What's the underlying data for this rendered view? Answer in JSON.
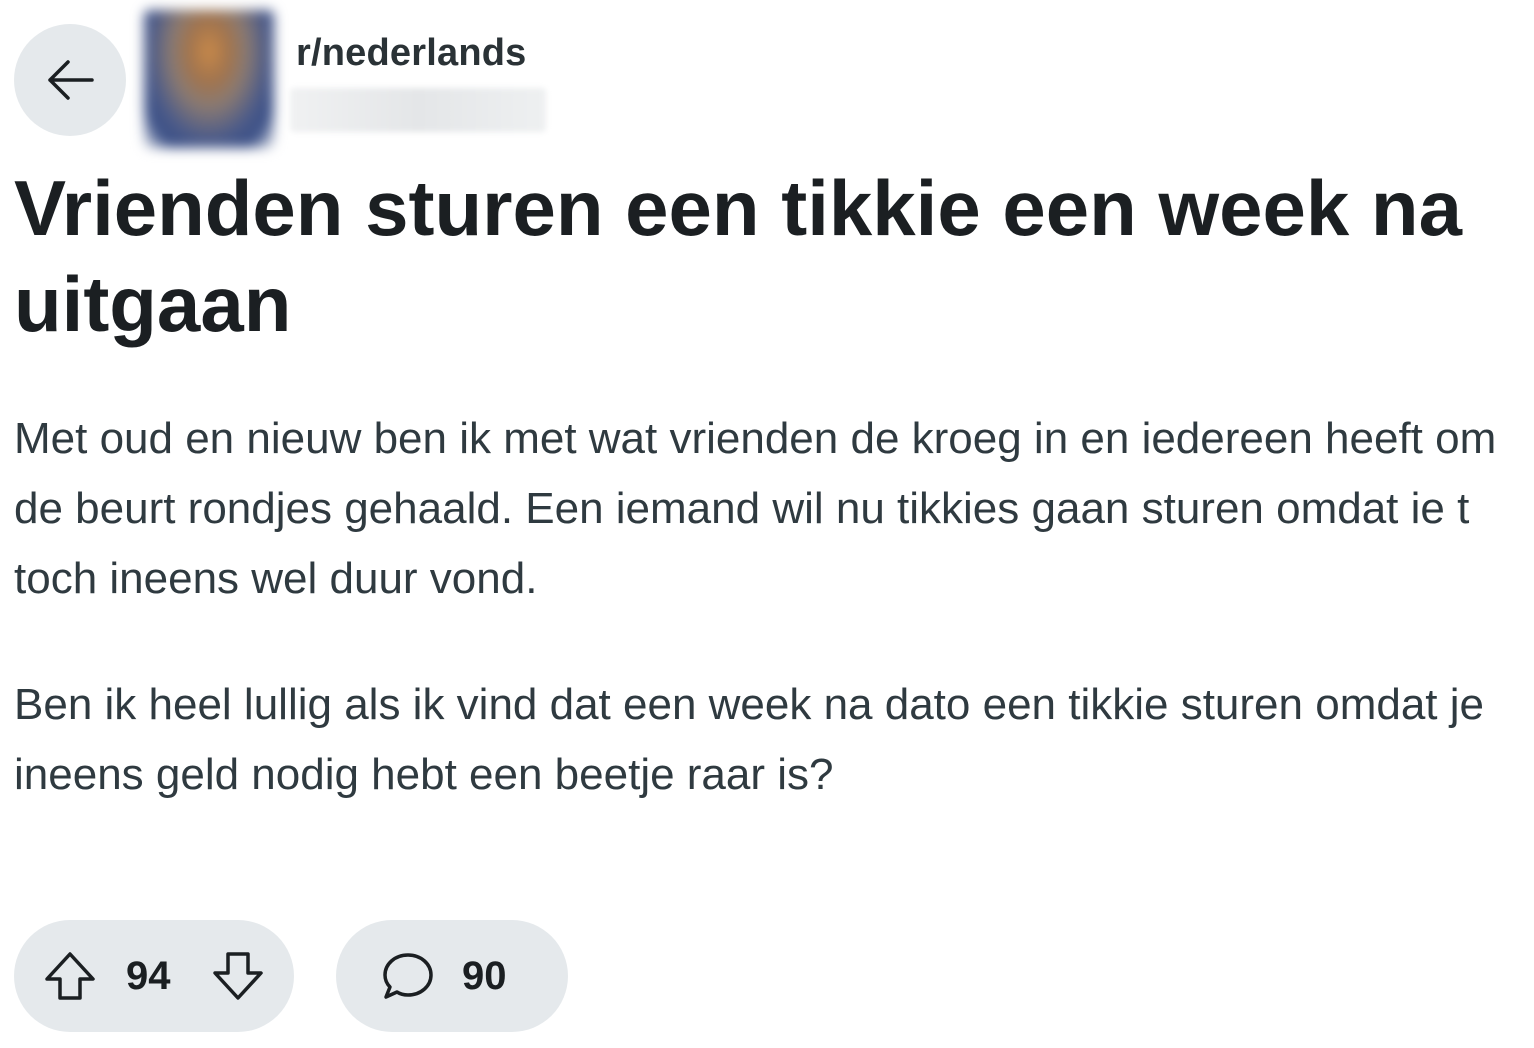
{
  "post": {
    "subreddit": "r/nederlands",
    "title": "Vrienden sturen een tikkie een week na uitgaan",
    "body": [
      "Met oud en nieuw ben ik met wat vrienden de kroeg in en iedereen heeft om de beurt rondjes gehaald. Een iemand wil nu tikkies gaan sturen omdat ie t toch ineens wel duur vond.",
      "Ben ik heel lullig als ik vind dat een week na dato een tikkie sturen omdat je ineens geld nodig hebt een beetje raar is?"
    ],
    "score": "94",
    "comment_count": "90"
  },
  "icons": {
    "back": "arrow-left-icon",
    "upvote": "arrow-up-icon",
    "downvote": "arrow-down-icon",
    "comments": "speech-bubble-icon"
  },
  "colors": {
    "pill_background": "#e5e9ec",
    "title_text": "#1b1f22",
    "body_text": "#2f3a40"
  }
}
